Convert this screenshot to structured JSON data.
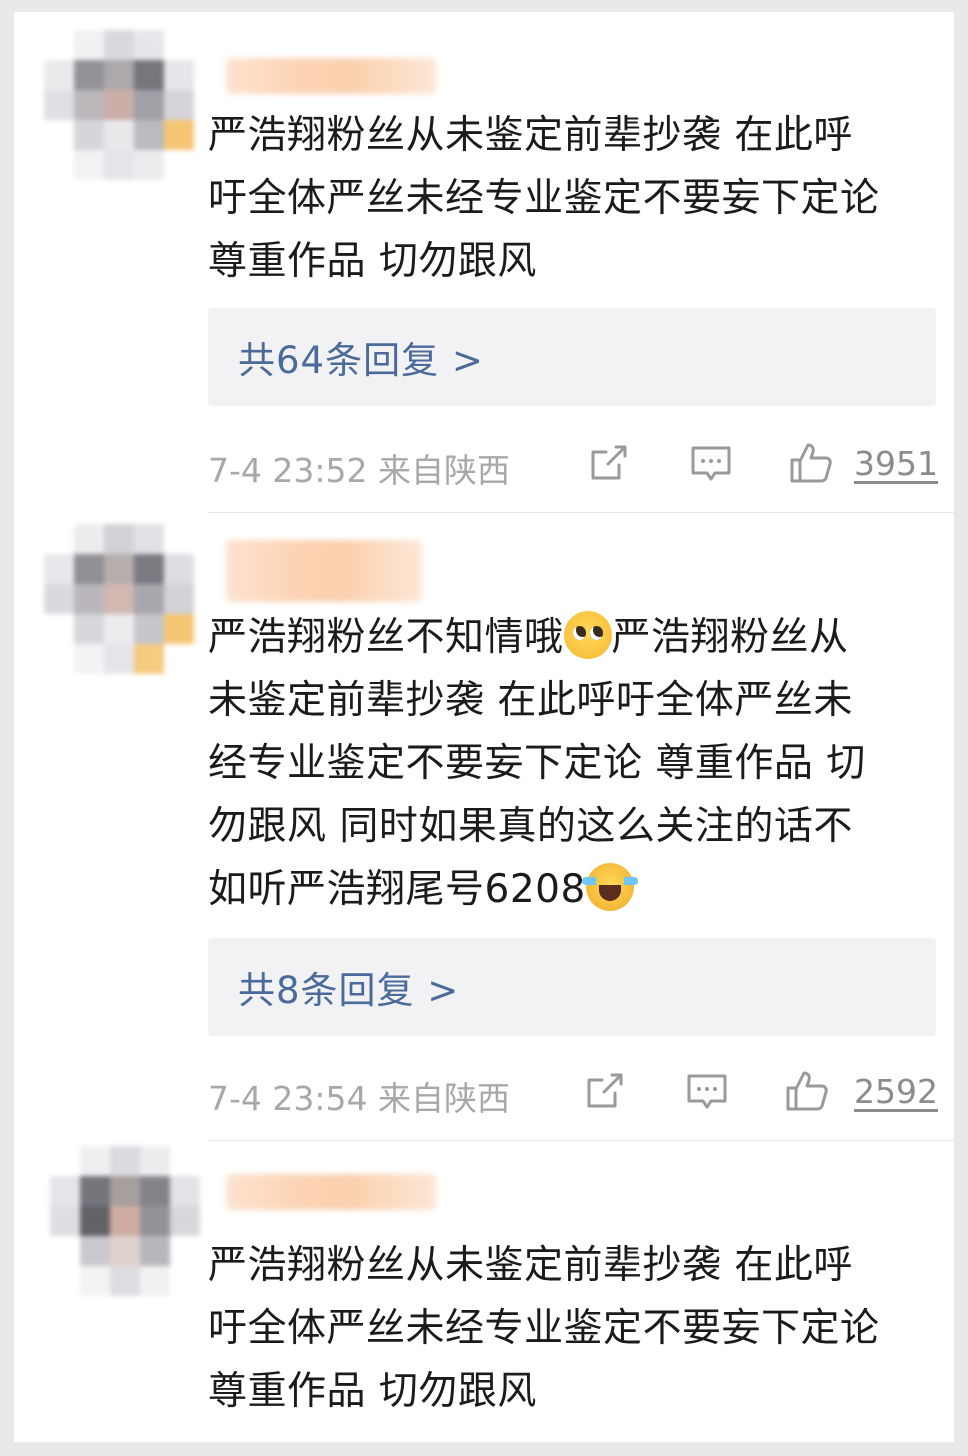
{
  "comments": [
    {
      "text": "严浩翔粉丝从未鉴定前辈抄袭 在此呼\n吁全体严丝未经专业鉴定不要妄下定论\n尊重作品 切勿跟风",
      "reply_label": "共64条回复 >",
      "meta": "7-4 23:52  来自陕西",
      "likes": "3951",
      "icons": [
        "share-icon",
        "comment-icon",
        "thumbs-up-icon"
      ]
    },
    {
      "text_part1": "严浩翔粉丝不知情哦",
      "text_part2": "严浩翔粉丝从\n未鉴定前辈抄袭 在此呼吁全体严丝未\n经专业鉴定不要妄下定论 尊重作品 切\n勿跟风 同时如果真的这么关注的话不\n如听严浩翔尾号6208",
      "emojis": [
        "pleading-face-emoji",
        "crying-face-emoji"
      ],
      "reply_label": "共8条回复 >",
      "meta": "7-4 23:54  来自陕西",
      "likes": "2592",
      "icons": [
        "share-icon",
        "comment-icon",
        "thumbs-up-icon"
      ]
    },
    {
      "text": "严浩翔粉丝从未鉴定前辈抄袭 在此呼\n吁全体严丝未经专业鉴定不要妄下定论\n尊重作品 切勿跟风"
    }
  ],
  "colors": {
    "reply_link": "#4a6b9a",
    "meta_text": "#a8a8a8",
    "reply_box_bg": "#f2f2f4",
    "body_text": "#1b1b1b"
  }
}
